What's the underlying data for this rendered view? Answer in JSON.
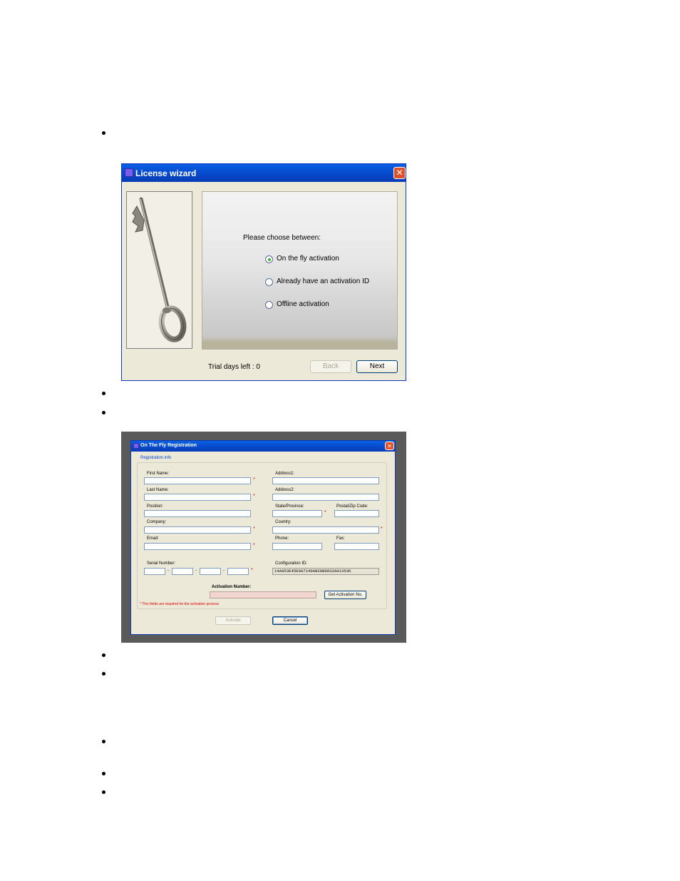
{
  "license_wizard": {
    "title": "License wizard",
    "close_label": "✕",
    "choose_label": "Please choose between:",
    "options": [
      {
        "label": "On the fly activation",
        "selected": true
      },
      {
        "label": "Already have an activation ID",
        "selected": false
      },
      {
        "label": "Offline activation",
        "selected": false
      }
    ],
    "trial_text": "Trial days left : 0",
    "back_label": "Back",
    "next_label": "Next"
  },
  "registration": {
    "title": "On The Fly Registration",
    "close_label": "✕",
    "group_title": "Registration info",
    "labels": {
      "first_name": "First Name:",
      "last_name": "Last Name:",
      "position": "Position:",
      "company": "Company:",
      "email": "Email:",
      "serial_number": "Serial Number:",
      "address1": "Address1:",
      "address2": "Address2:",
      "state": "State/Province:",
      "postal": "Postal/Zip Code:",
      "country": "Country:",
      "phone": "Phone:",
      "fax": "Fax:",
      "configuration_id": "Configuration ID:",
      "activation_number": "Activation Number:"
    },
    "required_mark": "*",
    "serial_separator": "-",
    "configuration_id": "14A053E45E0A7140AB29B9832A013536",
    "get_activation_label": "Get Activation No.",
    "required_note": "* This fields are required for the activation process",
    "activate_label": "Activate",
    "cancel_label": "Cancel"
  },
  "colors": {
    "titlebar": "#0548c8",
    "window_bg": "#ece9d8",
    "close_button": "#e0502a",
    "required": "#e00000",
    "activation_field": "#f3d5cf"
  }
}
